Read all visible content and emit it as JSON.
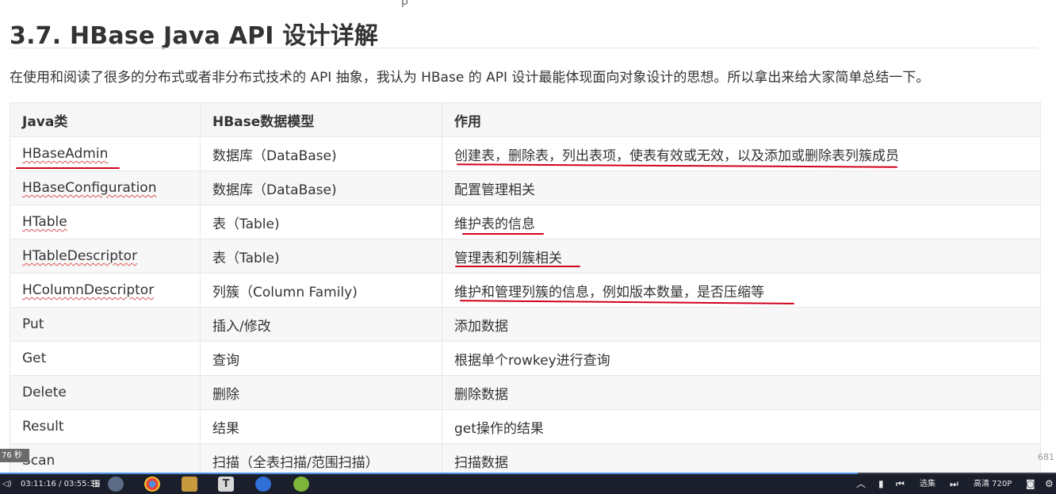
{
  "page": {
    "cutoff_glyph": "p",
    "title": "3.7. HBase Java API 设计详解",
    "intro": "在使用和阅读了很多的分布式或者非分布式技术的 API 抽象，我认为 HBase 的 API 设计最能体现面向对象设计的思想。所以拿出来给大家简单总结一下。"
  },
  "table": {
    "headers": [
      "Java类",
      "HBase数据模型",
      "作用"
    ],
    "rows": [
      {
        "cls": "HBaseAdmin",
        "model": "数据库（DataBase)",
        "role": "创建表，删除表，列出表项，使表有效或无效，以及添加或删除表列簇成员"
      },
      {
        "cls": "HBaseConfiguration",
        "model": "数据库（DataBase)",
        "role": "配置管理相关"
      },
      {
        "cls": "HTable",
        "model": "表（Table)",
        "role": "维护表的信息"
      },
      {
        "cls": "HTableDescriptor",
        "model": "表（Table)",
        "role": "管理表和列簇相关"
      },
      {
        "cls": "HColumnDescriptor",
        "model": "列簇（Column Family)",
        "role": "维护和管理列簇的信息，例如版本数量，是否压缩等"
      },
      {
        "cls": "Put",
        "model": "插入/修改",
        "role": "添加数据"
      },
      {
        "cls": "Get",
        "model": "查询",
        "role": "根据单个rowkey进行查询"
      },
      {
        "cls": "Delete",
        "model": "删除",
        "role": "删除数据"
      },
      {
        "cls": "Result",
        "model": "结果",
        "role": "get操作的结果"
      },
      {
        "cls": "Scan",
        "model": "扫描（全表扫描/范围扫描）",
        "role": "扫描数据"
      }
    ]
  },
  "overlay": {
    "side_badge": "76 秒",
    "side_count": "681"
  },
  "player": {
    "time": "03:11:16 / 03:55:35",
    "progress": 0.812,
    "select_label": "选集",
    "quality_label": "高清 720P"
  },
  "colors": {
    "annotation_red": "#d0021b",
    "taskbar": "#1a1f2b",
    "progress_fill": "#4a90e2"
  }
}
